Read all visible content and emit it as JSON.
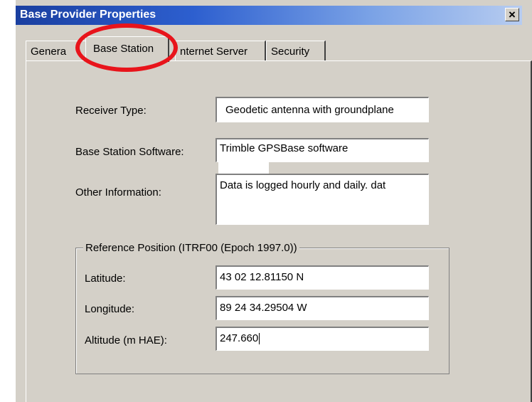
{
  "window": {
    "title": "Base Provider Properties",
    "close_glyph": "×"
  },
  "tabs": [
    {
      "label": "General",
      "visible_label": "Genera",
      "active": false
    },
    {
      "label": "Base Station",
      "active": true
    },
    {
      "label": "Internet Server",
      "visible_label": "nternet Server",
      "active": false
    },
    {
      "label": "Security",
      "active": false
    }
  ],
  "form": {
    "receiver_type": {
      "label": "Receiver Type:",
      "value": "Geodetic antenna with groundplane"
    },
    "software": {
      "label": "Base Station Software:",
      "value": "Trimble GPSBase software"
    },
    "other_info": {
      "label": "Other Information:",
      "value": "Data is logged hourly and daily. dat"
    }
  },
  "reference_position": {
    "legend": "Reference Position (ITRF00 (Epoch 1997.0))",
    "latitude": {
      "label": "Latitude:",
      "value": "43 02 12.81150 N"
    },
    "longitude": {
      "label": "Longitude:",
      "value": "89 24 34.29504 W"
    },
    "altitude": {
      "label": "Altitude (m HAE):",
      "value": "247.660"
    }
  },
  "annotation": {
    "color": "#e8141b",
    "target": "Base Station tab"
  }
}
